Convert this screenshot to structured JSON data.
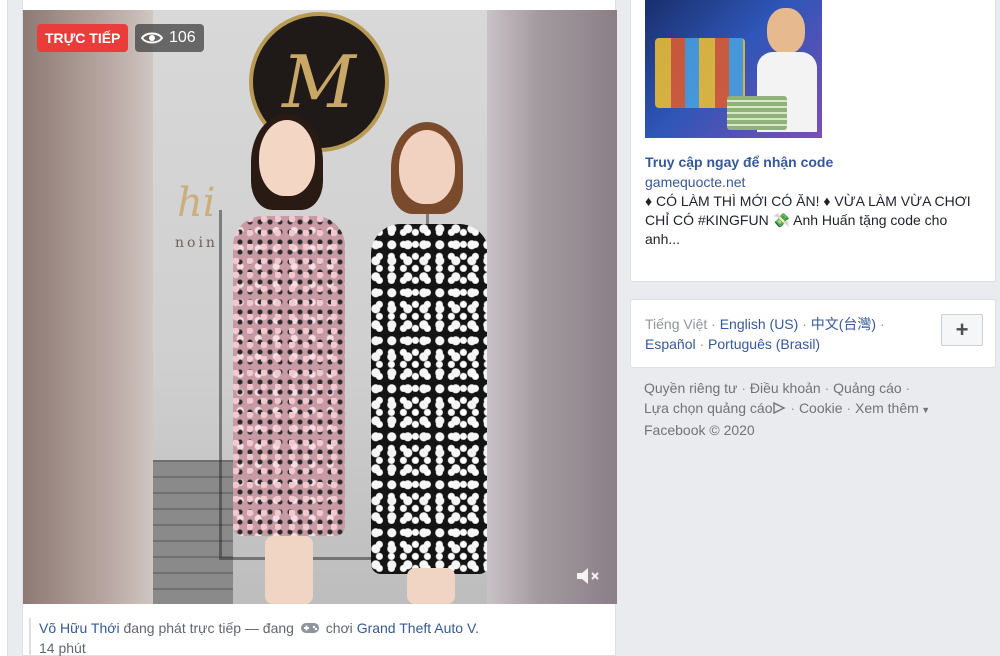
{
  "video": {
    "live_label": "TRỰC TIẾP",
    "viewer_count": "106",
    "logo_letter": "M",
    "brand_text": "noin",
    "brand_script": "hi"
  },
  "caption": {
    "author": "Võ Hữu Thới",
    "action": "đang phát trực tiếp — đang",
    "verb": "chơi",
    "game": "Grand Theft Auto V.",
    "time": "14 phút"
  },
  "ad": {
    "title": "Truy cập ngay để nhận code",
    "domain": "gamequocte.net",
    "body": "♦ CÓ LÀM THÌ MỚI CÓ ĂN! ♦ VỪA LÀM VỪA CHƠI CHỈ CÓ #KINGFUN 💸 Anh Huấn tặng code cho anh..."
  },
  "languages": {
    "current": "Tiếng Việt",
    "links": [
      "English (US)",
      "中文(台灣)",
      "Español",
      "Português (Brasil)"
    ],
    "add_label": "+"
  },
  "footer": {
    "privacy": "Quyền riêng tư",
    "terms": "Điều khoản",
    "advertising": "Quảng cáo",
    "ad_choices": "Lựa chọn quảng cáo",
    "cookies": "Cookie",
    "more": "Xem thêm",
    "copyright": "Facebook © 2020"
  },
  "colors": {
    "live_red": "#eb3c3c",
    "link_blue": "#365899",
    "page_bg": "#e9ebee"
  },
  "icons": [
    "eye-icon",
    "mute-icon",
    "game-controller-icon",
    "adchoices-icon",
    "caret-down-icon",
    "plus-icon"
  ]
}
